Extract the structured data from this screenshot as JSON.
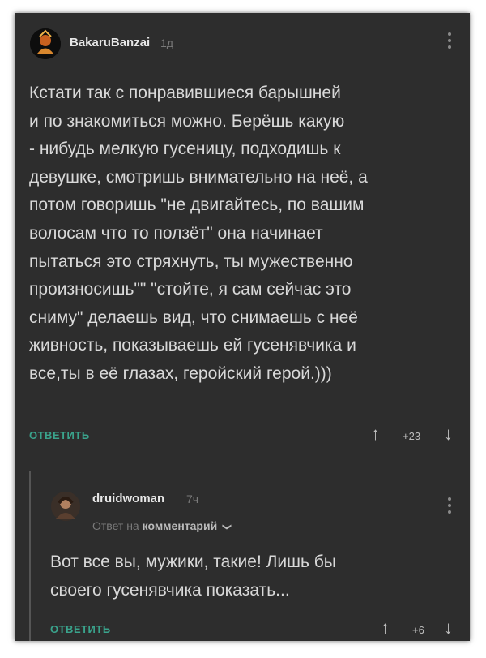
{
  "comment1": {
    "username": "BakaruBanzai",
    "time": "1д",
    "text_lines": [
      "Кстати так с понравившиеся барышней",
      "и по знакомиться можно. Берёшь какую",
      "- нибудь мелкую гусеницу, подходишь к",
      "девушке, смотришь внимательно на неё, а",
      "потом говоришь \"не двигайтесь, по вашим",
      "волосам что то ползёт\" она начинает",
      "пытаться это стряхнуть, ты мужественно",
      "произносишь\"\" \"стойте, я сам сейчас это",
      "сниму\" делаешь вид, что снимаешь с неё",
      "живность, показываешь ей гусенявчика и",
      "все,ты в её глазах, геройский герой.)))"
    ],
    "reply_label": "ОТВЕТИТЬ",
    "score": "+23",
    "upvote_icon": "↑",
    "downvote_icon": "↓"
  },
  "comment2": {
    "username": "druidwoman",
    "time": "7ч",
    "reply_prefix": "Ответ на",
    "reply_target": "комментарий",
    "chevron": "❯",
    "text_lines": [
      "Вот все вы, мужики, такие! Лишь бы",
      "своего гусенявчика показать..."
    ],
    "reply_label": "ОТВЕТИТЬ",
    "score": "+6",
    "upvote_icon": "↑",
    "downvote_icon": "↓"
  },
  "colors": {
    "background": "#2d2d2d",
    "accent": "#3aa38c",
    "text": "#d9d9d9",
    "muted": "#7a7a7a"
  }
}
